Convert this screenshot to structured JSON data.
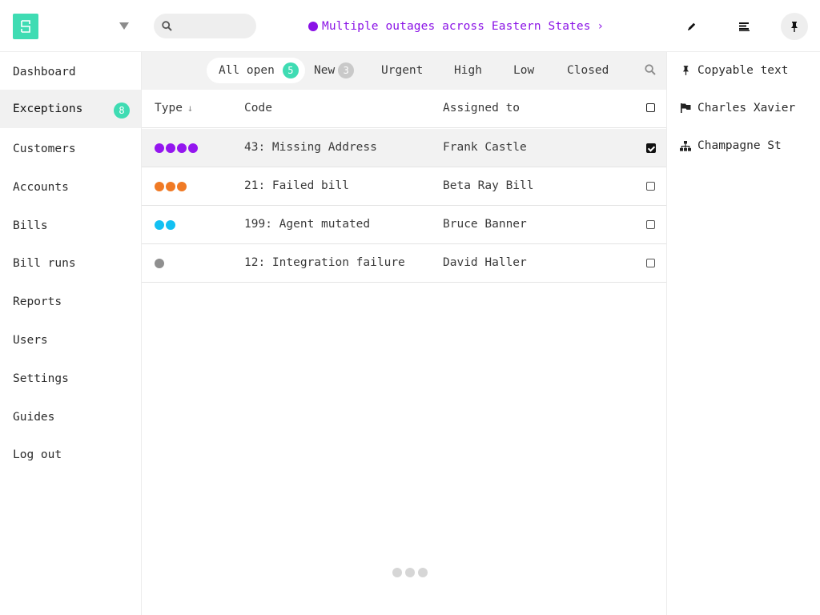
{
  "topbar": {
    "logo_icon": "brand-logo-icon",
    "dropdown_icon": "caret-down-icon",
    "search": {
      "placeholder": "",
      "value": "",
      "icon": "search-icon"
    },
    "alert": {
      "text": "Multiple outages across Eastern States",
      "chevron": "›",
      "color": "#8a12e6"
    },
    "actions": [
      {
        "icon": "pencil-icon"
      },
      {
        "icon": "list-icon"
      },
      {
        "icon": "pin-icon"
      }
    ]
  },
  "sidebar": {
    "items": [
      {
        "label": "Dashboard"
      },
      {
        "label": "Exceptions",
        "badge": "8",
        "active": true
      },
      {
        "label": "Customers"
      },
      {
        "label": "Accounts"
      },
      {
        "label": "Bills"
      },
      {
        "label": "Bill runs"
      },
      {
        "label": "Reports"
      },
      {
        "label": "Users"
      },
      {
        "label": "Settings"
      },
      {
        "label": "Guides"
      },
      {
        "label": "Log out"
      }
    ]
  },
  "filters": {
    "tabs": [
      {
        "label": "All open",
        "count": "5",
        "active": true
      },
      {
        "label": "New",
        "count": "3"
      },
      {
        "label": "Urgent"
      },
      {
        "label": "High"
      },
      {
        "label": "Low"
      },
      {
        "label": "Closed"
      }
    ],
    "search_icon": "search-icon"
  },
  "table": {
    "headers": {
      "type": "Type",
      "type_sort": "↓",
      "code": "Code",
      "assigned": "Assigned to"
    },
    "rows": [
      {
        "priority": 4,
        "color": "#9416ef",
        "code": "43: Missing Address",
        "assigned": "Frank Castle",
        "checked": true
      },
      {
        "priority": 3,
        "color": "#f07a25",
        "code": "21: Failed bill",
        "assigned": "Beta Ray Bill",
        "checked": false
      },
      {
        "priority": 2,
        "color": "#13c0f2",
        "code": "199: Agent mutated",
        "assigned": "Bruce Banner",
        "checked": false
      },
      {
        "priority": 1,
        "color": "#8f8f8f",
        "code": "12: Integration failure",
        "assigned": "David Haller",
        "checked": false
      }
    ]
  },
  "rightpanel": {
    "items": [
      {
        "label": "Copyable text",
        "icon": "pin-icon"
      },
      {
        "label": "Charles Xavier",
        "icon": "flag-icon"
      },
      {
        "label": "Champagne St",
        "icon": "sitemap-icon"
      }
    ]
  },
  "colors": {
    "accent": "#3fdcb3",
    "alert": "#8a12e6"
  }
}
